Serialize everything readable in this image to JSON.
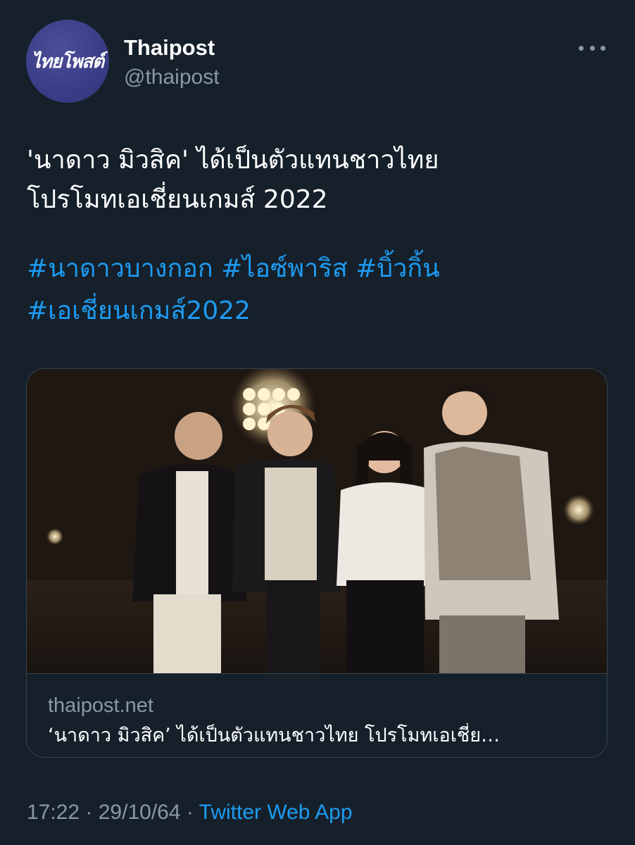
{
  "author": {
    "avatar_text": "ไทยโพสต์",
    "display_name": "Thaipost",
    "handle": "@thaipost"
  },
  "tweet": {
    "text_line1": "'นาดาว มิวสิค'  ได้เป็นตัวแทนชาวไทย",
    "text_line2": "โปรโมทเอเชี่ยนเกมส์ 2022",
    "hashtags": [
      "#นาดาวบางกอก",
      "#ไอซ์พาริส",
      "#บิ้วกิ้น",
      "#เอเชี่ยนเกมส์2022"
    ]
  },
  "card": {
    "domain": "thaipost.net",
    "title": "‘นาดาว มิวสิค’ ได้เป็นตัวแทนชาวไทย โปรโมทเอเชี่ย…"
  },
  "footer": {
    "time": "17:22",
    "separator1": " · ",
    "date": "29/10/64",
    "separator2": " · ",
    "source": "Twitter Web App"
  },
  "icons": {
    "more": "more-dots-icon"
  },
  "colors": {
    "background": "#15202b",
    "link": "#1d9bf0",
    "secondary_text": "#8b98a5",
    "border": "#38444d",
    "avatar_bg": "#3a3d86"
  }
}
